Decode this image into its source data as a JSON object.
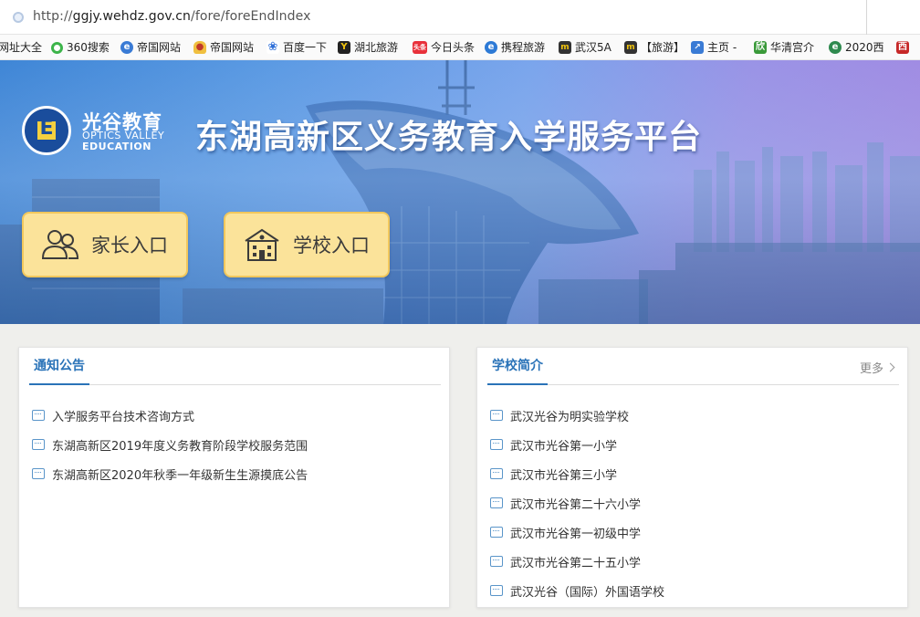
{
  "browser": {
    "url_prefix": "http://",
    "url_host": "ggjy.wehdz.gov.cn",
    "url_path": "/fore/foreEndIndex"
  },
  "bookmarks": [
    {
      "label": "网址大全",
      "icon": "none",
      "color": "#ffffff"
    },
    {
      "label": "360搜索",
      "icon": "circle-icon",
      "color": "#3cb44a"
    },
    {
      "label": "帝国网站",
      "icon": "globe-icon",
      "color": "#3a7bd5"
    },
    {
      "label": "帝国网站",
      "icon": "gourd-icon",
      "color": "#c0392b"
    },
    {
      "label": "百度一下",
      "icon": "paw-icon",
      "color": "#2e6fd8"
    },
    {
      "label": "湖北旅游",
      "icon": "y-icon",
      "color": "#222222"
    },
    {
      "label": "今日头条",
      "icon": "toutiao-icon",
      "color": "#e8313b"
    },
    {
      "label": "携程旅游",
      "icon": "globe-icon",
      "color": "#2d7ad6"
    },
    {
      "label": "武汉5A",
      "icon": "m-icon",
      "color": "#333333"
    },
    {
      "label": "【旅游】",
      "icon": "m-icon",
      "color": "#333333"
    },
    {
      "label": "主页 -",
      "icon": "chart-icon",
      "color": "#3a7bd5"
    },
    {
      "label": "华清宫介",
      "icon": "leaf-icon",
      "color": "#3a9a3a"
    },
    {
      "label": "2020西",
      "icon": "globe-icon",
      "color": "#2f8a4f"
    },
    {
      "label": "西",
      "icon": "xi-icon",
      "color": "#c62828"
    }
  ],
  "banner": {
    "logo_letter": "E",
    "logo_cn": "光谷教育",
    "logo_en_1": "OPTICS VALLEY",
    "logo_en_2": "EDUCATION",
    "title": "东湖高新区义务教育入学服务平台",
    "entry_parent": "家长入口",
    "entry_school": "学校入口"
  },
  "notice": {
    "title": "通知公告",
    "items": [
      "入学服务平台技术咨询方式",
      "东湖高新区2019年度义务教育阶段学校服务范围",
      "东湖高新区2020年秋季一年级新生生源摸底公告"
    ]
  },
  "schools": {
    "title": "学校简介",
    "more": "更多",
    "items": [
      "武汉光谷为明实验学校",
      "武汉市光谷第一小学",
      "武汉市光谷第三小学",
      "武汉市光谷第二十六小学",
      "武汉市光谷第一初级中学",
      "武汉市光谷第二十五小学",
      "武汉光谷（国际）外国语学校"
    ]
  }
}
